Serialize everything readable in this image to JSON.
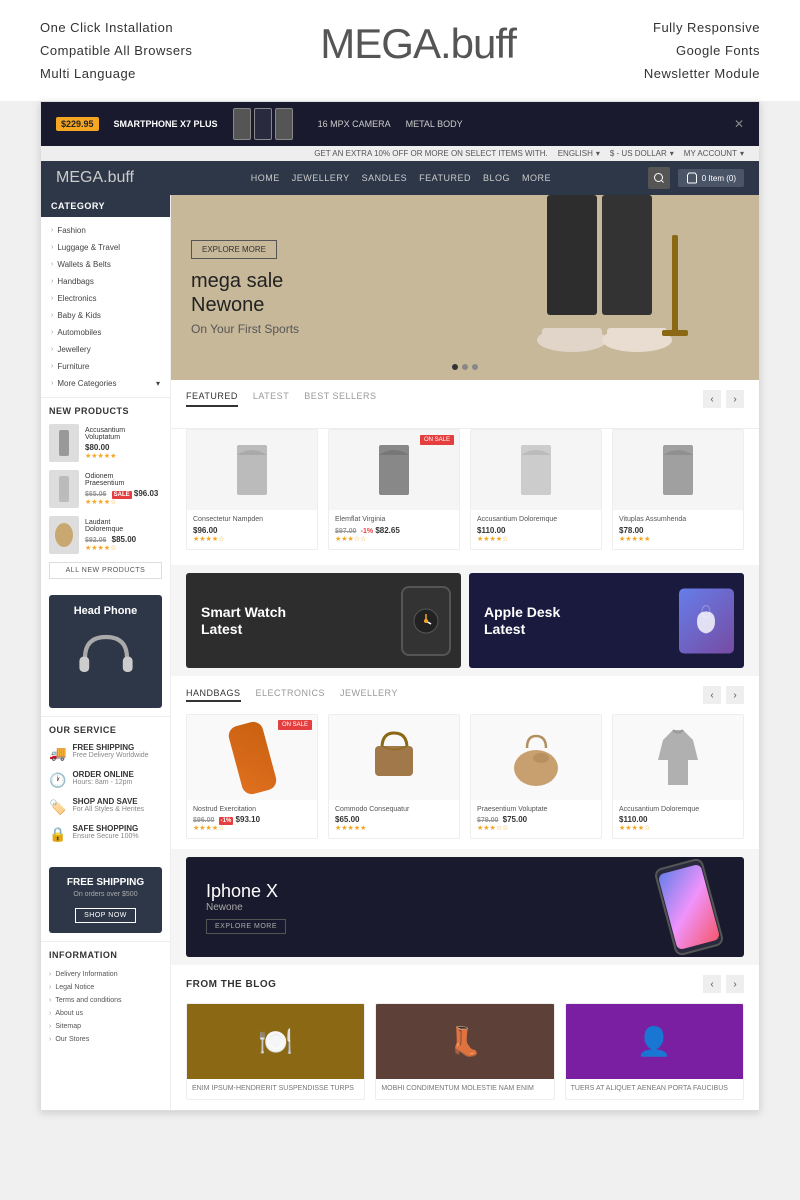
{
  "top_banner": {
    "left": {
      "line1": "One Click Installation",
      "line2": "Compatible All Browsers",
      "line3": "Multi Language"
    },
    "logo": "MEGA.",
    "logo_suffix": "buff",
    "right": {
      "line1": "Fully Responsive",
      "line2": "Google Fonts",
      "line3": "Newsletter Module"
    }
  },
  "promo_bar": {
    "tag": "$229.95",
    "text": "SMARTPHONE X7 PLUS",
    "util_text": "GET AN EXTRA 10% OFF OR MORE ON SELECT ITEMS WITH.",
    "spec1": "16 MPX CAMERA",
    "spec2": "METAL BODY"
  },
  "utility_bar": {
    "language": "ENGLISH",
    "currency": "$ - US DOLLAR",
    "account": "MY ACCOUNT"
  },
  "nav": {
    "logo": "MEGA.",
    "logo_suffix": "buff",
    "links": [
      "HOME",
      "JEWELLERY",
      "SANDLES",
      "FEATURED",
      "BLOG",
      "MORE"
    ],
    "cart_label": "0 Item (0)"
  },
  "sidebar": {
    "category_header": "CATEGORY",
    "categories": [
      "Fashion",
      "Luggage & Travel",
      "Wallets & Belts",
      "Handbags",
      "Electronics",
      "Baby & Kids",
      "Automobiles",
      "Jewellery",
      "Furniture",
      "More Categories"
    ]
  },
  "new_products": {
    "title": "NEW PRODUCTS",
    "products": [
      {
        "name": "Accusantium Voluptatum",
        "price": "$80.00",
        "old_price": ""
      },
      {
        "name": "Odionem Praesentium",
        "price": "$96.03",
        "old_price": "$65.06",
        "sale": true
      },
      {
        "name": "Laudant Doloremque",
        "price": "$85.00",
        "old_price": "$92.06"
      }
    ],
    "all_link": "ALL NEW PRODUCTS"
  },
  "headphone": {
    "title": "Head Phone"
  },
  "services": {
    "title": "OUR SERVICE",
    "items": [
      {
        "name": "FREE SHIPPING",
        "desc": "Free Delivery Worldwide"
      },
      {
        "name": "ORDER ONLINE",
        "desc": "Hours: 8am - 12pm"
      },
      {
        "name": "SHOP AND SAVE",
        "desc": "For All Styles & Herites"
      },
      {
        "name": "SAFE SHOPPING",
        "desc": "Ensure Secure 100%"
      }
    ]
  },
  "free_shipping": {
    "title": "FREE SHIPPING",
    "subtitle": "On orders over $500",
    "button": "SHOP NOW"
  },
  "information": {
    "title": "INFORMATION",
    "links": [
      "Delivery Information",
      "Legal Notice",
      "Terms and conditions",
      "About us",
      "Sitemap",
      "Our Stores"
    ]
  },
  "hero": {
    "explore_btn": "EXPLORE MORE",
    "title_line1": "mega sale",
    "title_line2": "Newone",
    "subtitle": "On Your First Sports"
  },
  "product_tabs": {
    "tabs": [
      "FEATURED",
      "LATEST",
      "BEST SELLERS"
    ],
    "active": "FEATURED",
    "products": [
      {
        "name": "Consectetur Nampden",
        "price": "$96.00",
        "old_price": "",
        "sale": false,
        "badge": ""
      },
      {
        "name": "Elemflat Virginia",
        "price": "$82.65",
        "old_price": "$97.00",
        "sale": true,
        "badge": "ON SALE"
      },
      {
        "name": "Accusantium Doloremque",
        "price": "$110.00",
        "old_price": "",
        "sale": false,
        "badge": ""
      },
      {
        "name": "Vituplas Assumhenda",
        "price": "$78.00",
        "old_price": "",
        "sale": false,
        "badge": ""
      }
    ]
  },
  "promo_banners": {
    "left": {
      "title_line1": "Smart Watch",
      "title_line2": "Latest"
    },
    "right": {
      "title_line1": "Apple Desk",
      "title_line2": "Latest"
    }
  },
  "handbags": {
    "tabs": [
      "HANDBAGS",
      "ELECTRONICS",
      "JEWELLERY"
    ],
    "active": "HANDBAGS",
    "products": [
      {
        "name": "Nostrud Exercitation",
        "price": "$93.10",
        "old_price": "$96.00",
        "sale": true,
        "badge": "ON SALE"
      },
      {
        "name": "Commodo Consequatur",
        "price": "$65.00",
        "old_price": "",
        "sale": false
      },
      {
        "name": "Praesentium Voluptate",
        "price": "$75.00",
        "old_price": "$79.00",
        "sale": false
      },
      {
        "name": "Accusantium Doloremque",
        "price": "$110.00",
        "old_price": "",
        "sale": false
      }
    ]
  },
  "iphone_banner": {
    "title": "Iphone X",
    "subtitle": "Newone",
    "button": "EXPLORE MORE"
  },
  "blog": {
    "title": "FROM THE BLOG",
    "posts": [
      {
        "caption": "ENIM IPSUM-HENDRERIT SUSPENDISSE TURPS"
      },
      {
        "caption": "MOBHI CONDIMENTUM MOLESTIE NAM ENIM"
      },
      {
        "caption": "TUERS AT ALIQUET AENEAN PORTA FAUCIBUS"
      }
    ]
  }
}
